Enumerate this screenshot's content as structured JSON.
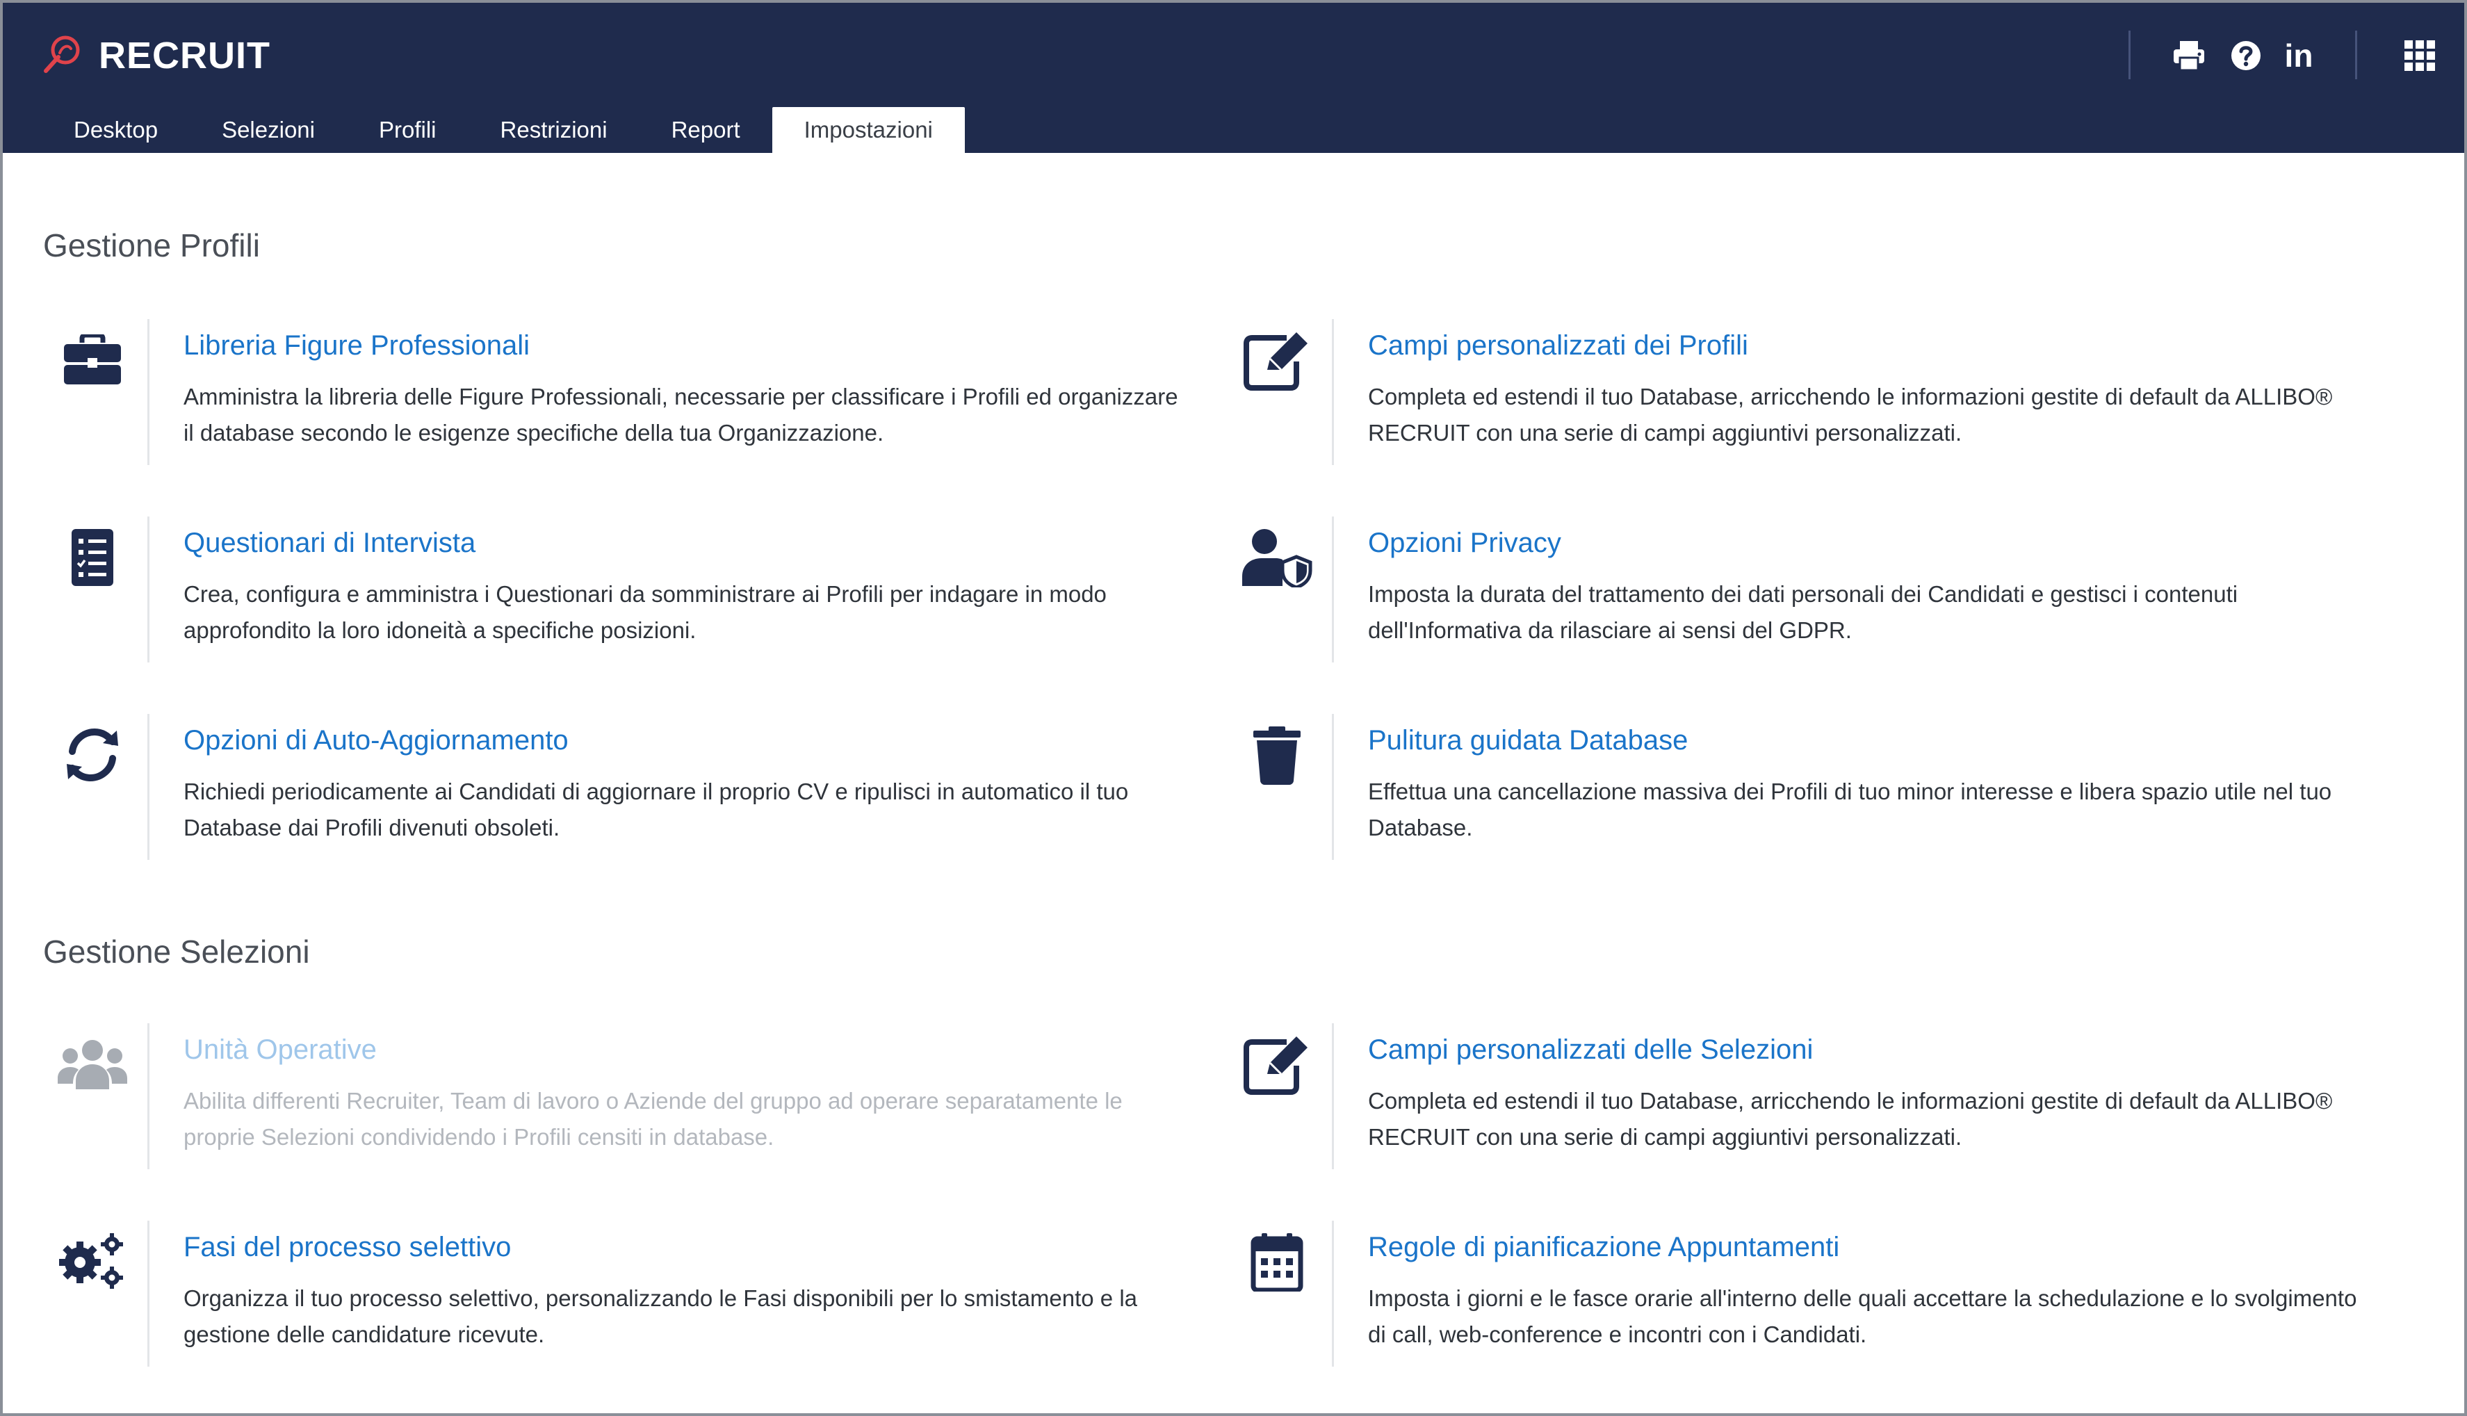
{
  "app": {
    "title": "RECRUIT",
    "brand_color": "#1f2b4d",
    "logo_color": "#e0434b",
    "linkedin_label": "in"
  },
  "header_icons": [
    "print-icon",
    "help-icon",
    "linkedin-icon",
    "apps-grid-icon"
  ],
  "tabs": [
    {
      "label": "Desktop",
      "active": false
    },
    {
      "label": "Selezioni",
      "active": false
    },
    {
      "label": "Profili",
      "active": false
    },
    {
      "label": "Restrizioni",
      "active": false
    },
    {
      "label": "Report",
      "active": false
    },
    {
      "label": "Impostazioni",
      "active": true
    }
  ],
  "sections": [
    {
      "title": "Gestione Profili",
      "items": [
        {
          "icon": "briefcase-icon",
          "title": "Libreria Figure Professionali",
          "desc": "Amministra la libreria delle Figure Professionali, necessarie per classificare i Profili ed organizzare il database secondo le esigenze specifiche della tua Organizzazione.",
          "disabled": false
        },
        {
          "icon": "edit-icon",
          "title": "Campi personalizzati dei Profili",
          "desc": "Completa ed estendi il tuo Database, arricchendo le informazioni gestite di default da ALLIBO® RECRUIT con una serie di campi aggiuntivi personalizzati.",
          "disabled": false
        },
        {
          "icon": "checklist-icon",
          "title": "Questionari di Intervista",
          "desc": "Crea, configura e amministra i Questionari da somministrare ai Profili per indagare in modo approfondito la loro idoneità a specifiche posizioni.",
          "disabled": false
        },
        {
          "icon": "user-shield-icon",
          "title": "Opzioni Privacy",
          "desc": "Imposta la durata del trattamento dei dati personali dei Candidati e gestisci i contenuti dell'Informativa da rilasciare ai sensi del GDPR.",
          "disabled": false
        },
        {
          "icon": "sync-icon",
          "title": "Opzioni di Auto-Aggiornamento",
          "desc": "Richiedi periodicamente ai Candidati di aggiornare il proprio CV e ripulisci in automatico il tuo Database dai Profili divenuti obsoleti.",
          "disabled": false
        },
        {
          "icon": "trash-icon",
          "title": "Pulitura guidata Database",
          "desc": "Effettua una cancellazione massiva dei Profili di tuo minor interesse e libera spazio utile nel tuo Database.",
          "disabled": false
        }
      ]
    },
    {
      "title": "Gestione Selezioni",
      "items": [
        {
          "icon": "users-icon",
          "title": "Unità Operative",
          "desc": "Abilita differenti Recruiter, Team di lavoro o Aziende del gruppo ad operare separatamente le proprie Selezioni condividendo i Profili censiti in database.",
          "disabled": true
        },
        {
          "icon": "edit-icon",
          "title": "Campi personalizzati delle Selezioni",
          "desc": "Completa ed estendi il tuo Database, arricchendo le informazioni gestite di default da ALLIBO® RECRUIT con una serie di campi aggiuntivi personalizzati.",
          "disabled": false
        },
        {
          "icon": "gears-icon",
          "title": "Fasi del processo selettivo",
          "desc": "Organizza il tuo processo selettivo, personalizzando le Fasi disponibili per lo smistamento e la gestione delle candidature ricevute.",
          "disabled": false
        },
        {
          "icon": "calendar-icon",
          "title": "Regole di pianificazione Appuntamenti",
          "desc": "Imposta i giorni e le fasce orarie all'interno delle quali accettare la schedulazione e lo svolgimento di call, web-conference e incontri con i Candidati.",
          "disabled": false
        }
      ]
    }
  ]
}
